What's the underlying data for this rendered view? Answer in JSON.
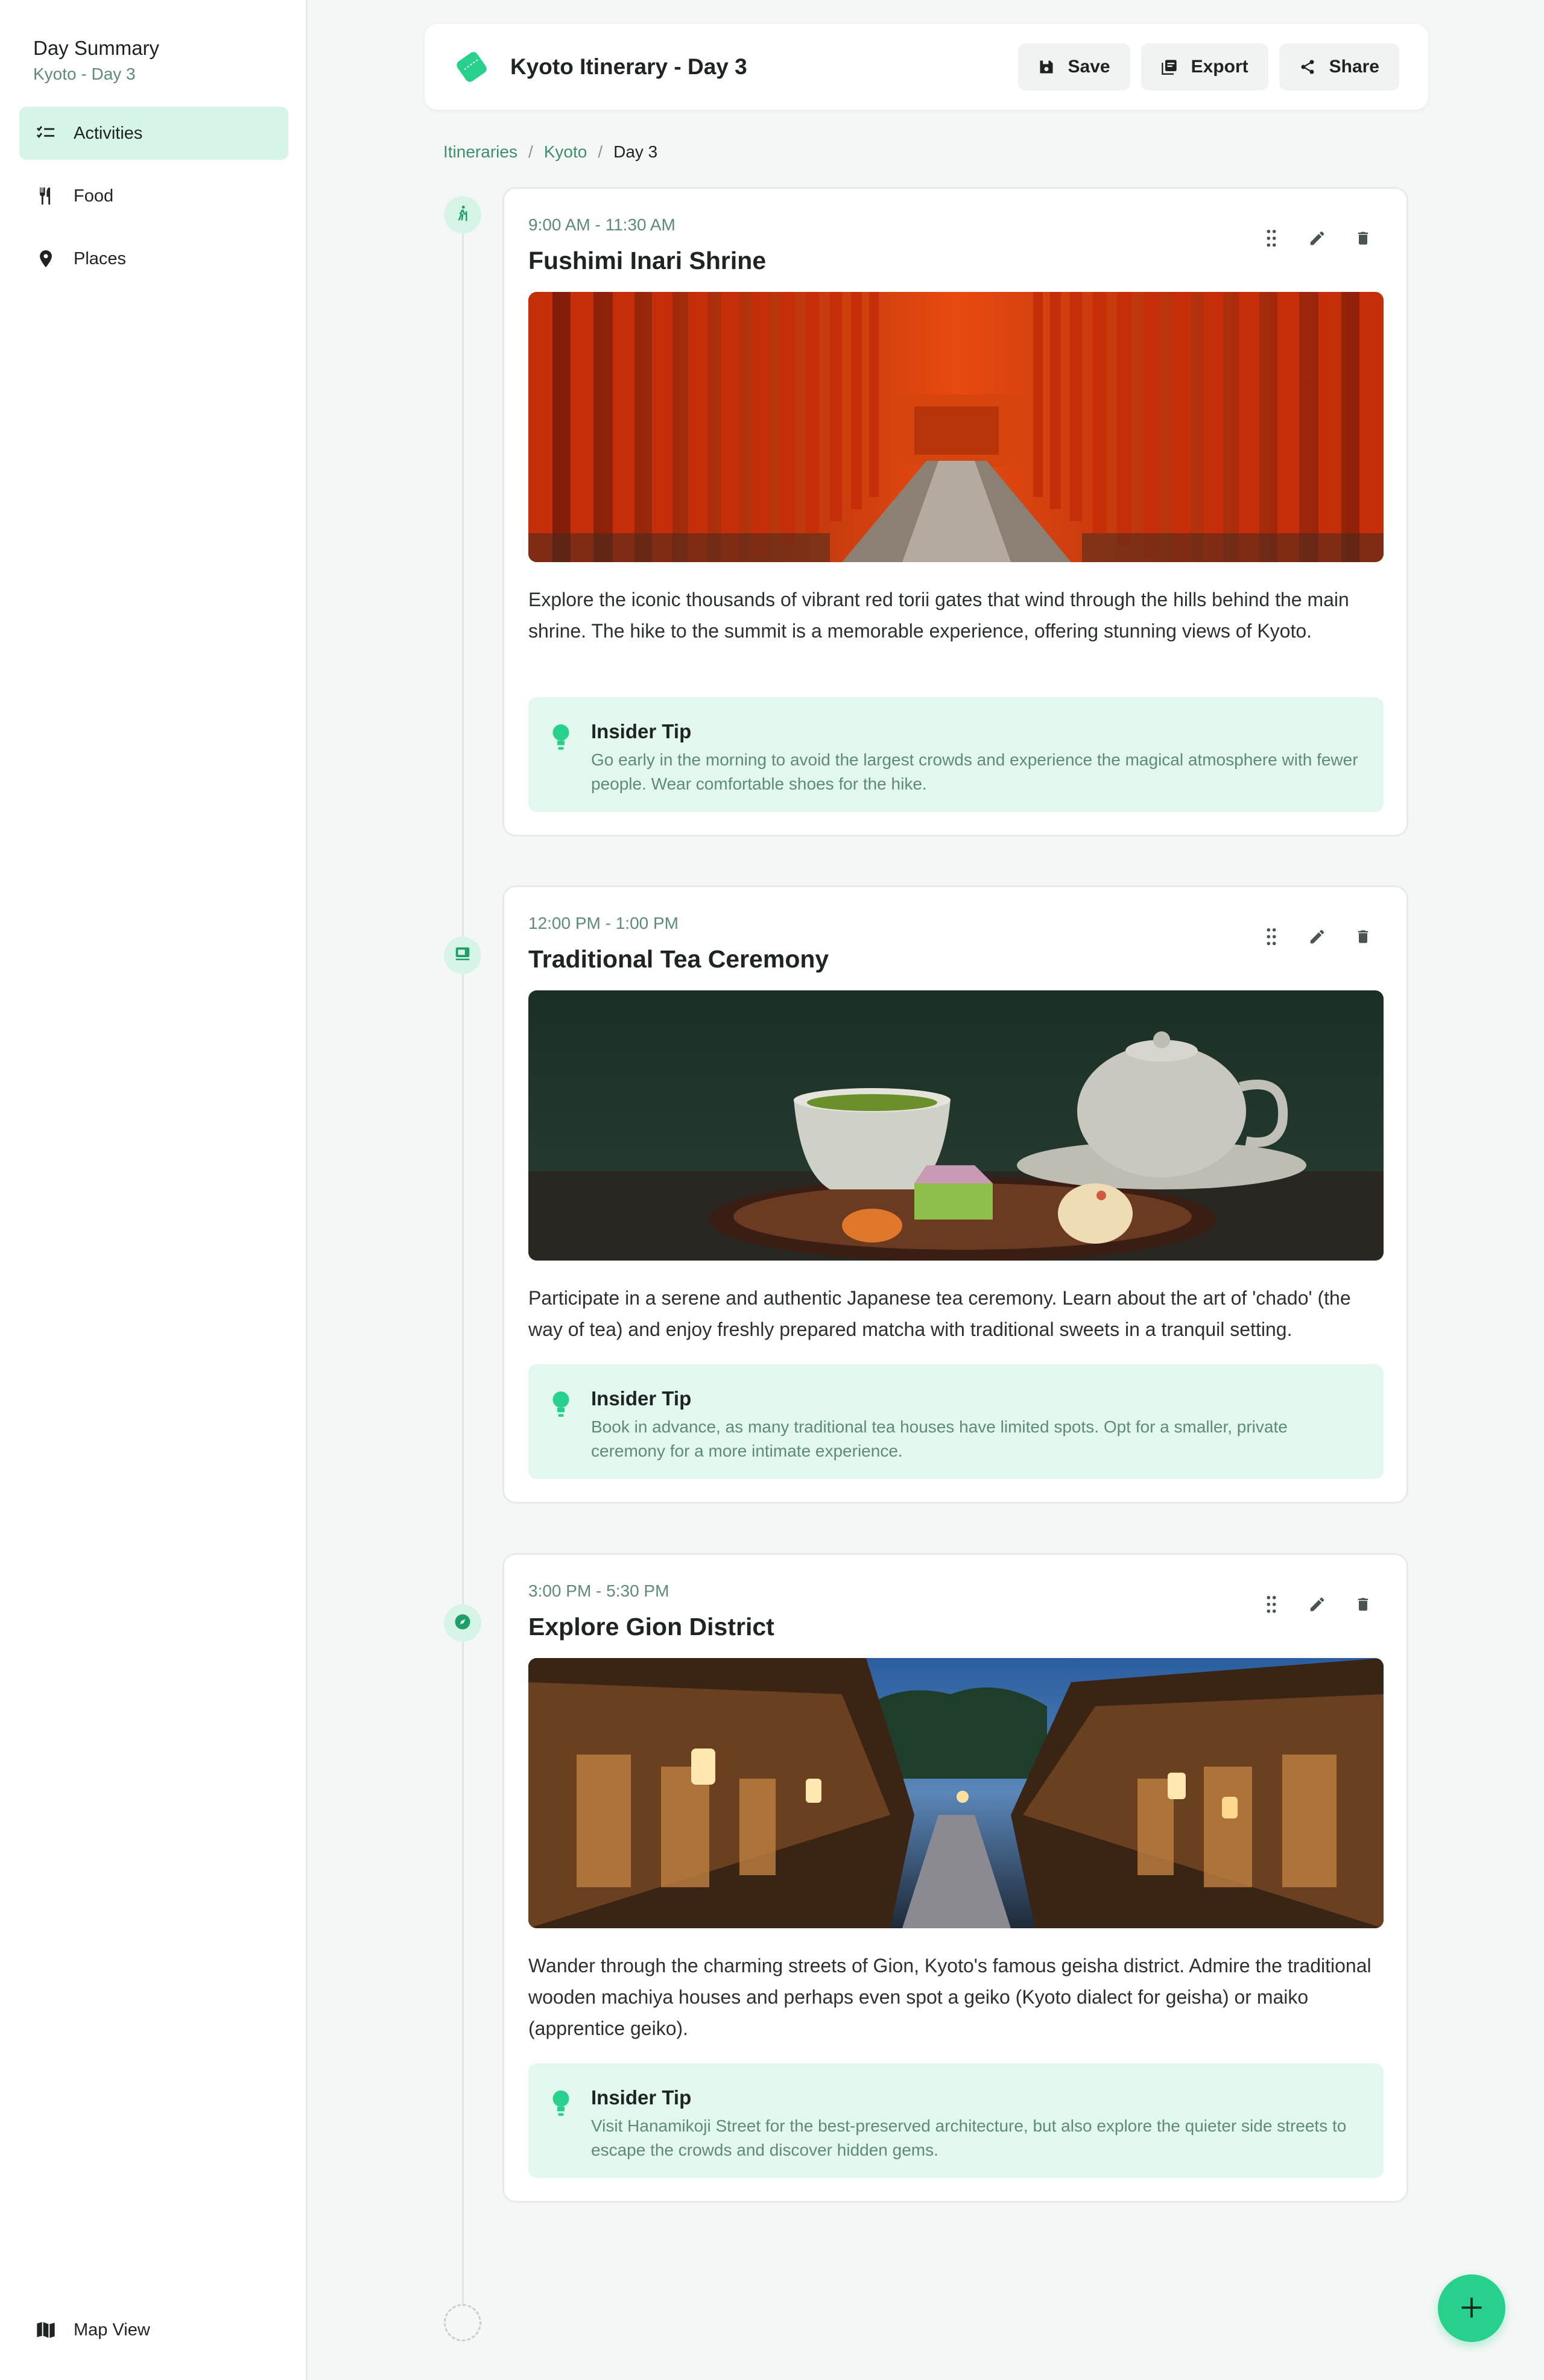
{
  "sidebar": {
    "title": "Day Summary",
    "subtitle": "Kyoto - Day 3",
    "items": [
      {
        "label": "Activities",
        "icon": "checklist-icon",
        "active": true
      },
      {
        "label": "Food",
        "icon": "fork-knife-icon",
        "active": false
      },
      {
        "label": "Places",
        "icon": "map-pin-icon",
        "active": false
      }
    ],
    "bottom_label": "Map View"
  },
  "header": {
    "title": "Kyoto Itinerary - Day 3",
    "save_label": "Save",
    "export_label": "Export",
    "share_label": "Share"
  },
  "breadcrumb": {
    "items": [
      "Itineraries",
      "Kyoto",
      "Day 3"
    ],
    "separator": "/"
  },
  "cards": [
    {
      "time": "9:00 AM - 11:30 AM",
      "title": "Fushimi Inari Shrine",
      "description": "Explore the iconic thousands of vibrant red torii gates that wind through the hills behind the main shrine. The hike to the summit is a memorable experience, offering stunning views of Kyoto.",
      "tip_title": "Insider Tip",
      "tip_text": "Go early in the morning to avoid the largest crowds and experience the magical atmosphere with fewer people. Wear comfortable shoes for the hike."
    },
    {
      "time": "12:00 PM - 1:00 PM",
      "title": "Traditional Tea Ceremony",
      "description": "Participate in a serene and authentic Japanese tea ceremony. Learn about the art of 'chado' (the way of tea) and enjoy freshly prepared matcha with traditional sweets in a tranquil setting.",
      "tip_title": "Insider Tip",
      "tip_text": "Book in advance, as many traditional tea houses have limited spots. Opt for a smaller, private ceremony for a more intimate experience."
    },
    {
      "time": "3:00 PM - 5:30 PM",
      "title": "Explore Gion District",
      "description": "Wander through the charming streets of Gion, Kyoto's famous geisha district. Admire the traditional wooden machiya houses and perhaps even spot a geiko (Kyoto dialect for geisha) or maiko (apprentice geiko).",
      "tip_title": "Insider Tip",
      "tip_text": "Visit Hanamikoji Street for the best-preserved architecture, but also explore the quieter side streets to escape the crowds and discover hidden gems."
    }
  ],
  "colors": {
    "accent": "#27d08b",
    "accent_soft": "#d7f5e7",
    "tip_bg": "#e2f7ee",
    "muted_green": "#5e8a77"
  }
}
